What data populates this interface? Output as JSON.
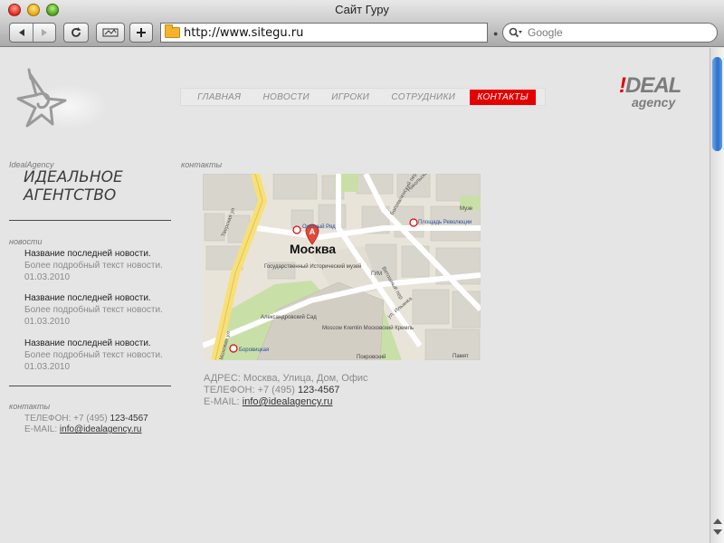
{
  "window": {
    "title": "Сайт Гуру"
  },
  "toolbar": {
    "url": "http://www.sitegu.ru",
    "search_placeholder": "Google"
  },
  "header": {
    "menu": [
      {
        "label": "ГЛАВНАЯ",
        "active": false
      },
      {
        "label": "НОВОСТИ",
        "active": false
      },
      {
        "label": "ИГРОКИ",
        "active": false
      },
      {
        "label": "СОТРУДНИКИ",
        "active": false
      },
      {
        "label": "КОНТАКТЫ",
        "active": true
      }
    ],
    "brand_mark": "!",
    "brand_word": "DEAL",
    "brand_sub": "agency",
    "accent_color": "#e30000"
  },
  "sidebar": {
    "tag": "IdealAgency",
    "title_line1": "ИДЕАЛЬНОЕ",
    "title_line2": "АГЕНТСТВО",
    "news_section": "новости",
    "news": [
      {
        "headline": "Название последней новости.",
        "text": "Более подробный текст новости.",
        "date": "01.03.2010"
      },
      {
        "headline": "Название последней новости.",
        "text": "Более подробный текст новости.",
        "date": "01.03.2010"
      },
      {
        "headline": "Название последней новости.",
        "text": "Более подробный текст новости.",
        "date": "01.03.2010"
      }
    ],
    "contacts_section": "контакты",
    "phone_label": "ТЕЛЕФОН: +7 (495)",
    "phone_number": "123-4567",
    "email_label": "E-MAIL:",
    "email": "info@idealagency.ru"
  },
  "main": {
    "section_tag": "контакты",
    "map": {
      "pin_letter": "A",
      "city": "Москва",
      "labels": {
        "tverskaya": "Тверская ул",
        "okhotny": "Охотный Ряд",
        "revolution": "Площадь Революции",
        "museum": "Государственный Исторический музей",
        "gum": "ГУМ",
        "kremlin": "Moscow Kremlin Московский Кремль",
        "alexander": "Александровский Сад",
        "borovitskaya": "Боровицкая",
        "pokrovsky": "Покровский",
        "mokhovaya": "Моховая ул",
        "ilyinka": "ул. Ильинка",
        "vetoshny": "Ветошный пер",
        "bogoyavlensky": "Богоявленский пер",
        "nikolskaya": "Никольская",
        "muzei": "Музе",
        "pamyat": "Памят"
      }
    },
    "address": "АДРЕС: Москва, Улица, Дом, Офис",
    "phone_label": "ТЕЛЕФОН: +7 (495)",
    "phone_number": "123-4567",
    "email_label": "E-MAIL:",
    "email": "info@idealagency.ru"
  }
}
